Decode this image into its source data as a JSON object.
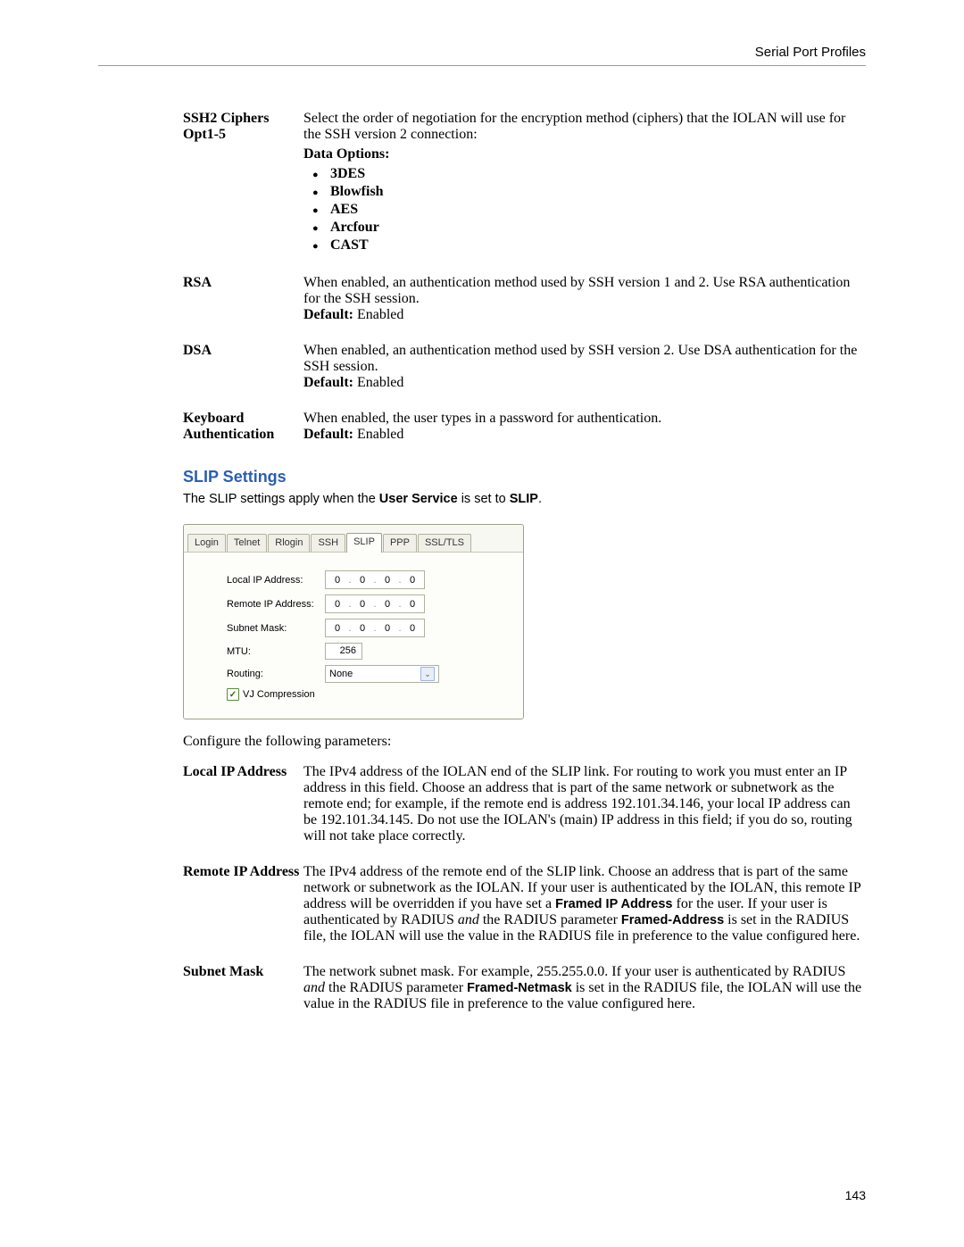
{
  "header": {
    "title": "Serial Port Profiles"
  },
  "page_number": "143",
  "params1": {
    "ssh2": {
      "label": "SSH2 Ciphers Opt1-5",
      "text": "Select the order of negotiation for the encryption method (ciphers) that the IOLAN will use for the SSH version 2 connection:",
      "data_options_label": "Data Options:",
      "opts": [
        "3DES",
        "Blowfish",
        "AES",
        "Arcfour",
        "CAST"
      ]
    },
    "rsa": {
      "label": "RSA",
      "text": "When enabled, an authentication method used by SSH version 1 and 2. Use RSA authentication for the SSH session.",
      "default_label": "Default:",
      "default_value": " Enabled"
    },
    "dsa": {
      "label": "DSA",
      "text": "When enabled, an authentication method used by SSH version 2. Use DSA authentication for the SSH session.",
      "default_label": "Default:",
      "default_value": " Enabled"
    },
    "kbd": {
      "label": "Keyboard Authentication",
      "text": "When enabled, the user types in a password for authentication.",
      "default_label": "Default:",
      "default_value": " Enabled"
    }
  },
  "section": {
    "title": "SLIP Settings",
    "intro_a": "The SLIP settings apply when the ",
    "intro_b": "User Service",
    "intro_c": " is set to ",
    "intro_d": "SLIP",
    "intro_e": "."
  },
  "ui": {
    "tabs": [
      "Login",
      "Telnet",
      "Rlogin",
      "SSH",
      "SLIP",
      "PPP",
      "SSL/TLS"
    ],
    "active_tab": 4,
    "rows": {
      "local_ip": {
        "label": "Local IP Address:",
        "value": [
          "0",
          "0",
          "0",
          "0"
        ]
      },
      "remote_ip": {
        "label": "Remote IP Address:",
        "value": [
          "0",
          "0",
          "0",
          "0"
        ]
      },
      "subnet": {
        "label": "Subnet Mask:",
        "value": [
          "0",
          "0",
          "0",
          "0"
        ]
      },
      "mtu": {
        "label": "MTU:",
        "value": "256"
      },
      "routing": {
        "label": "Routing:",
        "value": "None"
      },
      "vj": {
        "label": "VJ Compression",
        "checked": true
      }
    }
  },
  "configure_text": "Configure the following parameters:",
  "params2": {
    "local_ip": {
      "label": "Local IP Address",
      "text": "The IPv4 address of the IOLAN end of the SLIP link. For routing to work you must enter an IP address in this field. Choose an address that is part of the same network or subnetwork as the remote end; for example, if the remote end is address 192.101.34.146, your local IP address can be 192.101.34.145. Do not use the IOLAN's (main) IP address in this field; if you do so, routing will not take place correctly."
    },
    "remote_ip": {
      "label": "Remote IP Address",
      "t1": "The IPv4 address of the remote end of the SLIP link. Choose an address that is part of the same network or subnetwork as the IOLAN. If your user is authenticated by the IOLAN, this remote IP address will be overridden if you have set a ",
      "b1": "Framed IP Address",
      "t2": " for the user. If your user is authenticated by RADIUS ",
      "i1": "and",
      "t3": " the RADIUS parameter ",
      "b2": "Framed-Address",
      "t4": " is set in the RADIUS file, the IOLAN will use the value in the RADIUS file in preference to the value configured here."
    },
    "subnet": {
      "label": "Subnet Mask",
      "t1": "The network subnet mask. For example, 255.255.0.0. If your user is authenticated by RADIUS ",
      "i1": "and",
      "t2": " the RADIUS parameter ",
      "b1": "Framed-Netmask",
      "t3": " is set in the RADIUS file, the IOLAN will use the value in the RADIUS file in preference to the value configured here."
    }
  }
}
